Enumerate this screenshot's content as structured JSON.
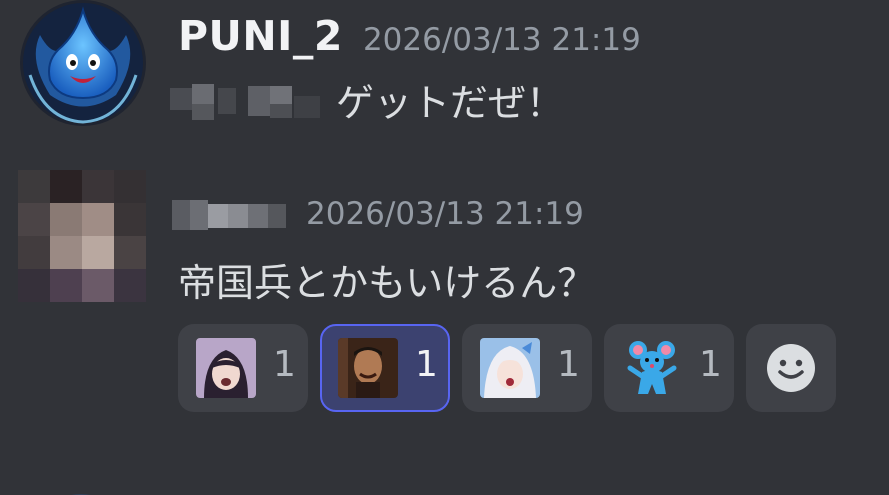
{
  "messages": [
    {
      "username": "PUNI_2",
      "timestamp": "2026/03/13 21:19",
      "text": "ゲットだぜ！",
      "avatar_icon": "slime-icon"
    },
    {
      "timestamp": "2026/03/13 21:19",
      "text": "帝国兵とかもいけるん？"
    }
  ],
  "reactions": [
    {
      "emoji": "anime-girl-shocked-emoji",
      "count": "1",
      "active": false
    },
    {
      "emoji": "man-laughing-emoji",
      "count": "1",
      "active": true
    },
    {
      "emoji": "white-haired-girl-emoji",
      "count": "1",
      "active": false
    },
    {
      "emoji": "blue-mouse-emoji",
      "count": "1",
      "active": false
    }
  ],
  "add_reaction_icon": "smiley-icon",
  "colors": {
    "background": "#313338",
    "reaction_bg": "#3f4147",
    "reaction_active_bg": "#3c4270",
    "reaction_active_border": "#5865f2",
    "username": "#f2f3f5",
    "timestamp": "#949ba4"
  }
}
